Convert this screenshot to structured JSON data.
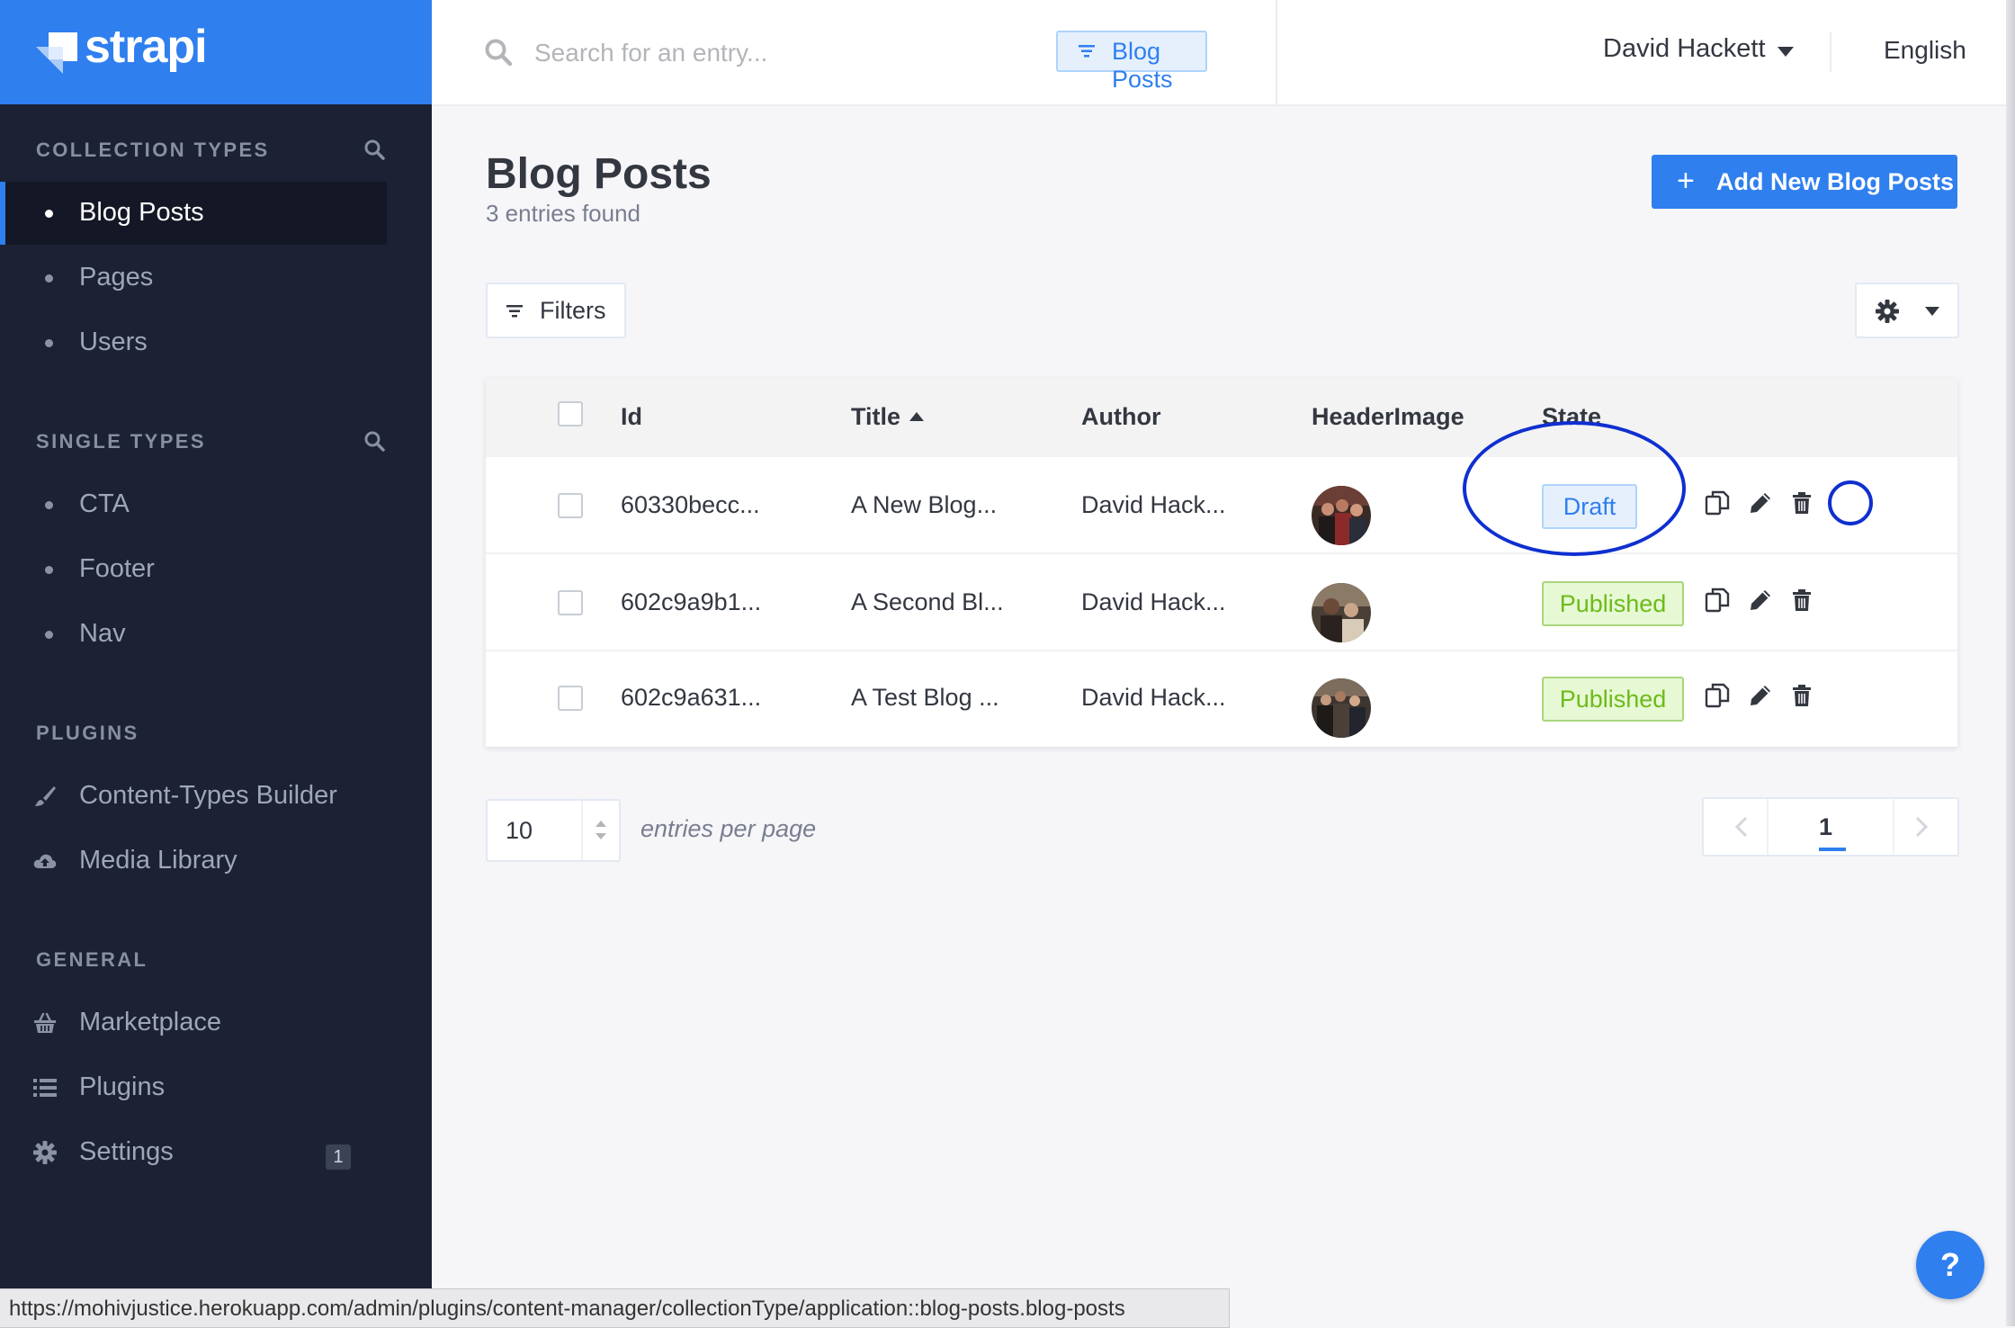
{
  "brand": {
    "name": "strapi"
  },
  "colors": {
    "accent": "#2f7fef",
    "sidebar": "#1c2133",
    "draft": "#2f7fef",
    "published": "#6dbb1a",
    "annotation": "#0f2fd0"
  },
  "sidebar": {
    "sections": [
      {
        "title": "COLLECTION TYPES",
        "searchable": true,
        "items": [
          {
            "label": "Blog Posts",
            "active": true
          },
          {
            "label": "Pages"
          },
          {
            "label": "Users"
          }
        ]
      },
      {
        "title": "SINGLE TYPES",
        "searchable": true,
        "items": [
          {
            "label": "CTA"
          },
          {
            "label": "Footer"
          },
          {
            "label": "Nav"
          }
        ]
      },
      {
        "title": "PLUGINS",
        "items": [
          {
            "label": "Content-Types Builder",
            "icon": "paintbrush-icon"
          },
          {
            "label": "Media Library",
            "icon": "cloud-upload-icon"
          }
        ]
      },
      {
        "title": "GENERAL",
        "items": [
          {
            "label": "Marketplace",
            "icon": "basket-icon"
          },
          {
            "label": "Plugins",
            "icon": "list-icon"
          },
          {
            "label": "Settings",
            "icon": "gear-icon",
            "badge": "1"
          }
        ]
      }
    ]
  },
  "topbar": {
    "search_placeholder": "Search for an entry...",
    "search_scope": "Blog Posts",
    "user": "David Hackett",
    "language": "English"
  },
  "main": {
    "title": "Blog Posts",
    "subtitle": "3 entries found",
    "add_button": "Add New Blog Posts",
    "filters_button": "Filters",
    "table": {
      "columns": [
        "Id",
        "Title",
        "Author",
        "HeaderImage",
        "State"
      ],
      "sorted_column": "Title",
      "rows": [
        {
          "id": "60330becc...",
          "title": "A New Blog...",
          "author": "David Hack...",
          "state": "Draft"
        },
        {
          "id": "602c9a9b1...",
          "title": "A Second Bl...",
          "author": "David Hack...",
          "state": "Published"
        },
        {
          "id": "602c9a631...",
          "title": "A Test Blog ...",
          "author": "David Hack...",
          "state": "Published"
        }
      ]
    },
    "pagination": {
      "per_page": "10",
      "per_page_label": "entries per page",
      "current_page": "1"
    }
  },
  "help_label": "?",
  "status_url": "https://mohivjustice.herokuapp.com/admin/plugins/content-manager/collectionType/application::blog-posts.blog-posts"
}
